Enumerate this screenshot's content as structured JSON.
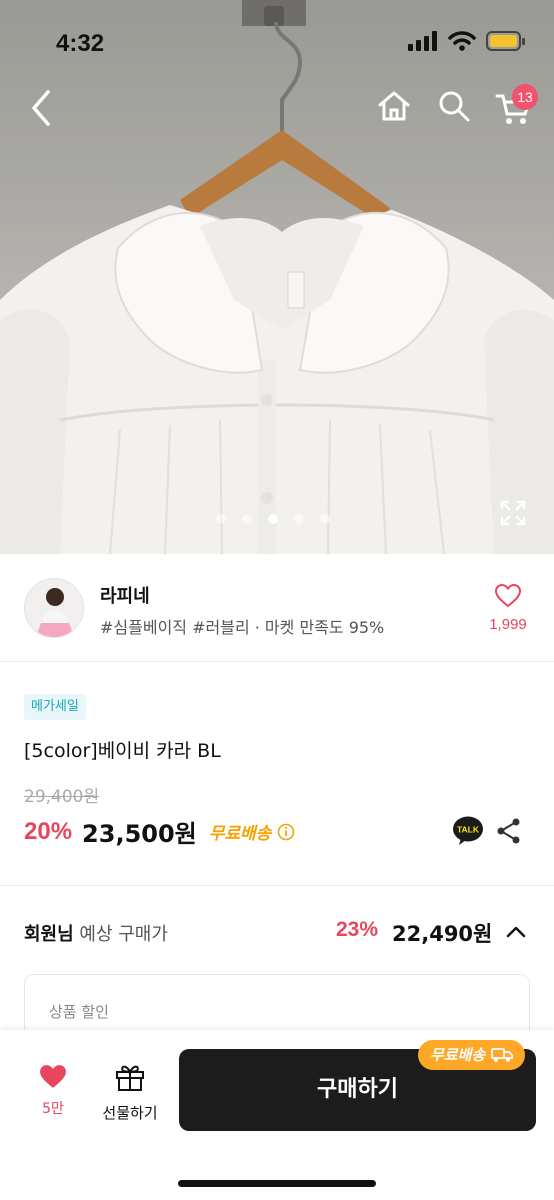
{
  "status_bar": {
    "time": "4:32"
  },
  "nav": {
    "cart_count": "13"
  },
  "gallery": {
    "dots": 5,
    "active_index": 2
  },
  "seller": {
    "name": "라피네",
    "tags": "#심플베이직 #러블리 · 마켓 만족도 95%",
    "like_count": "1,999"
  },
  "product": {
    "badge": "메가세일",
    "title": "[5color]베이비 카라 BL",
    "original_price": "29,400원",
    "discount": "20%",
    "price": "23,500원",
    "free_shipping": "무료배송"
  },
  "member_price": {
    "label_bold": "회원님",
    "label_rest": " 예상 구매가",
    "discount": "23%",
    "price": "22,490원"
  },
  "discount_box": {
    "title": "상품 할인"
  },
  "bottom_bar": {
    "like_count": "5만",
    "gift_label": "선물하기",
    "buy_label": "구매하기",
    "ship_pill": "무료배송"
  },
  "colors": {
    "accent_red": "#e8465e",
    "free_ship_orange": "#f5a300",
    "sale_badge_bg": "#e7f7fa",
    "sale_badge_text": "#1aa6bb",
    "buy_button": "#1c1c1c"
  }
}
